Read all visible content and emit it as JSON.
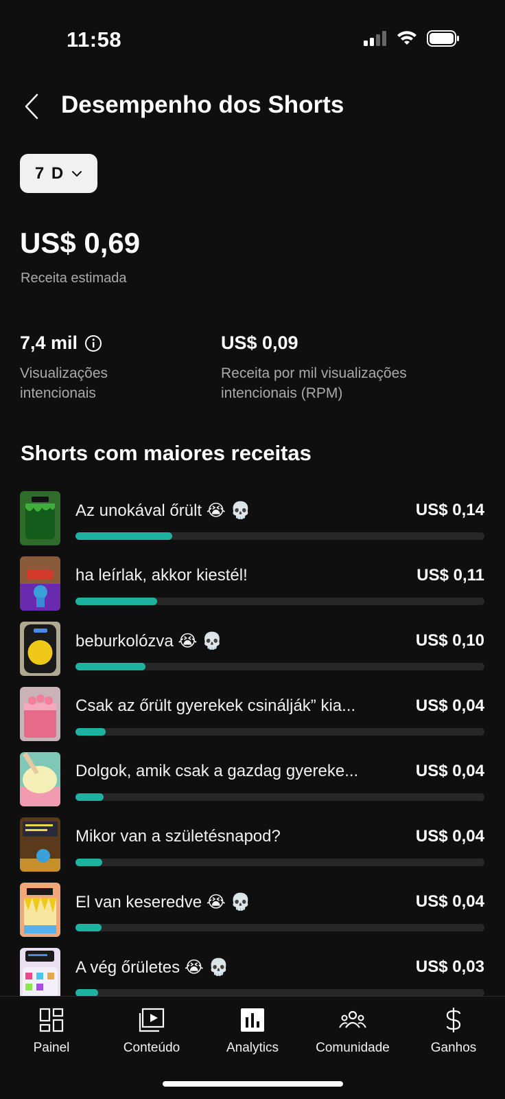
{
  "status_bar": {
    "time": "11:58"
  },
  "header": {
    "title": "Desempenho dos Shorts"
  },
  "period": {
    "selected": "7 D"
  },
  "summary": {
    "revenue_value": "US$ 0,69",
    "revenue_label": "Receita estimada",
    "views_value": "7,4 mil",
    "views_label_line1": "Visualizações",
    "views_label_line2": "intencionais",
    "rpm_value": "US$ 0,09",
    "rpm_label_line1": "Receita por mil visualizações",
    "rpm_label_line2": "intencionais (RPM)"
  },
  "section": {
    "title": "Shorts com maiores receitas"
  },
  "shorts": [
    {
      "title": "Az unokával őrült 😭 💀",
      "revenue": "US$ 0,14",
      "bar_fraction": 0.237
    },
    {
      "title": "ha leírlak, akkor kiestél!",
      "revenue": "US$ 0,11",
      "bar_fraction": 0.2
    },
    {
      "title": "beburkolózva 😭 💀",
      "revenue": "US$ 0,10",
      "bar_fraction": 0.171
    },
    {
      "title": "Csak az őrült gyerekek csinálják” kia...",
      "revenue": "US$ 0,04",
      "bar_fraction": 0.073
    },
    {
      "title": "Dolgok, amik csak a gazdag gyereke...",
      "revenue": "US$ 0,04",
      "bar_fraction": 0.069
    },
    {
      "title": "Mikor van a születésnapod?",
      "revenue": "US$ 0,04",
      "bar_fraction": 0.066
    },
    {
      "title": "El van keseredve 😭 💀",
      "revenue": "US$ 0,04",
      "bar_fraction": 0.063
    },
    {
      "title": "A vég őrületes 😭 💀",
      "revenue": "US$ 0,03",
      "bar_fraction": 0.056
    }
  ],
  "nav": [
    {
      "label": "Painel",
      "icon": "dashboard-icon"
    },
    {
      "label": "Conteúdo",
      "icon": "content-icon"
    },
    {
      "label": "Analytics",
      "icon": "analytics-icon"
    },
    {
      "label": "Comunidade",
      "icon": "community-icon"
    },
    {
      "label": "Ganhos",
      "icon": "earnings-icon"
    }
  ],
  "colors": {
    "accent": "#1eb3a1",
    "background": "#0f0f0f",
    "track": "#272727"
  }
}
